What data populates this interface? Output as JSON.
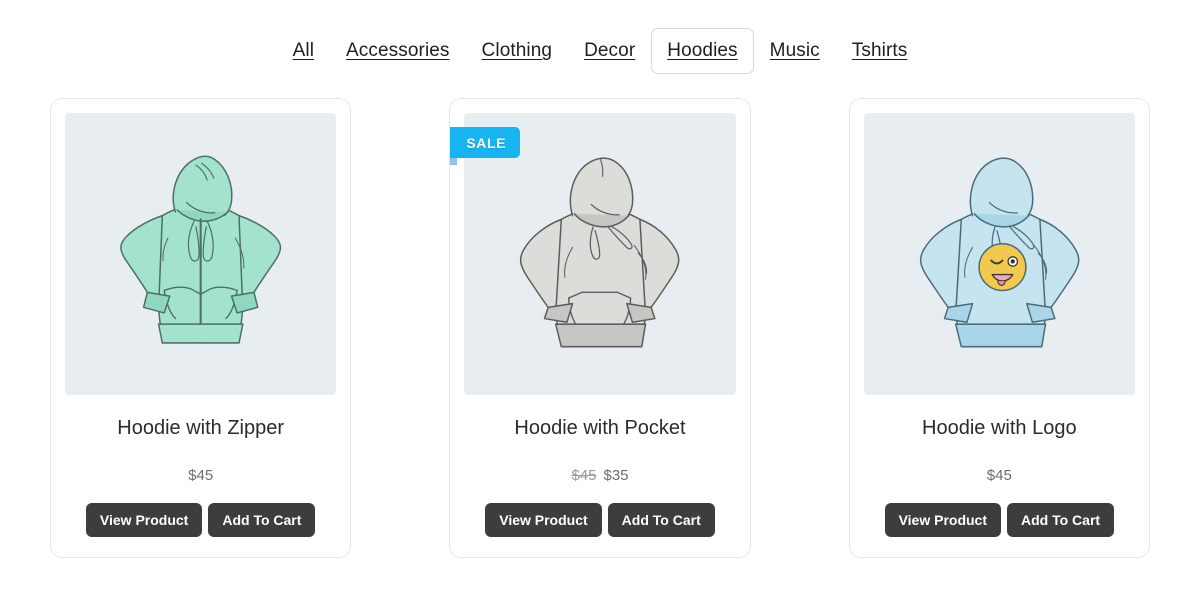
{
  "filters": {
    "items": [
      {
        "label": "All",
        "active": false
      },
      {
        "label": "Accessories",
        "active": false
      },
      {
        "label": "Clothing",
        "active": false
      },
      {
        "label": "Decor",
        "active": false
      },
      {
        "label": "Hoodies",
        "active": true
      },
      {
        "label": "Music",
        "active": false
      },
      {
        "label": "Tshirts",
        "active": false
      }
    ]
  },
  "colors": {
    "badge": "#16b4f0",
    "button": "#3d3d3d",
    "thumb_bg": "#e8edf1",
    "card_border": "#e6e6e6"
  },
  "buttons": {
    "view_product": "View Product",
    "add_to_cart": "Add To Cart"
  },
  "products": [
    {
      "title": "Hoodie with Zipper",
      "price": "$45",
      "price_old": "",
      "price_new": "",
      "on_sale": false,
      "badge_label": "",
      "image": "zip-up-hoodie-mint-sketch",
      "garment_color": "#a3e3cd",
      "garment_shade": "#7fd3b8",
      "garment_ink": "#4e6f66"
    },
    {
      "title": "Hoodie with Pocket",
      "price": "",
      "price_old": "$45",
      "price_new": "$35",
      "on_sale": true,
      "badge_label": "SALE",
      "image": "pullover-hoodie-gray-sketch",
      "garment_color": "#dcdcd8",
      "garment_shade": "#c6c6c2",
      "garment_ink": "#5c5c5c"
    },
    {
      "title": "Hoodie with Logo",
      "price": "$45",
      "price_old": "",
      "price_new": "",
      "on_sale": false,
      "badge_label": "",
      "image": "pullover-hoodie-lightblue-emoji-sketch",
      "garment_color": "#c5e4f0",
      "garment_shade": "#a8d5e8",
      "garment_ink": "#4a6b7c"
    }
  ]
}
